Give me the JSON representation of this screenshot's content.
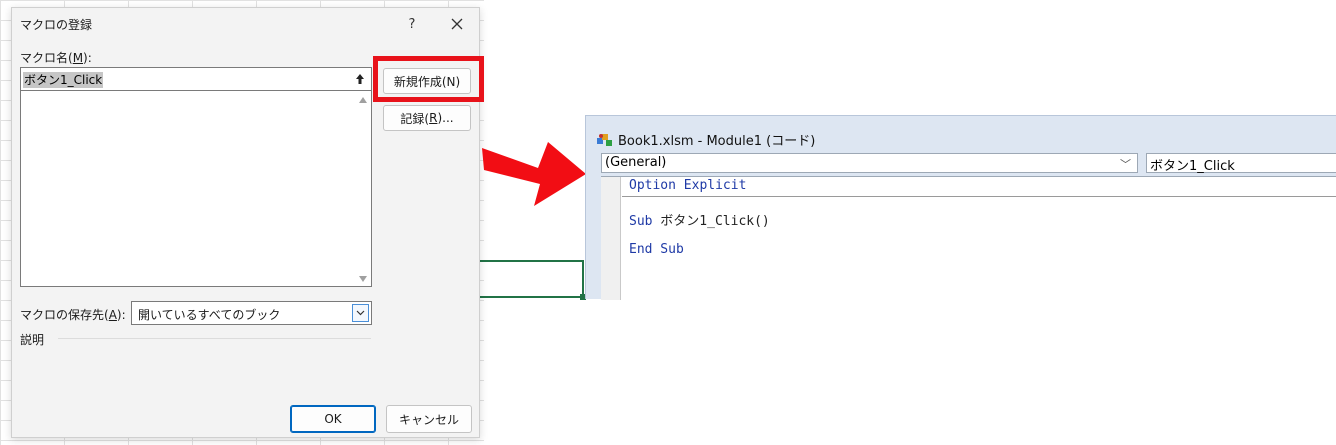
{
  "dialog": {
    "title": "マクロの登録",
    "help_label": "?",
    "macro_name_label_prefix": "マクロ名(",
    "macro_name_label_key": "M",
    "macro_name_label_suffix": "):",
    "macro_name_value": "ボタン1_Click",
    "new_button_label": "新規作成(N)",
    "record_button_prefix": "記録(",
    "record_button_key": "R",
    "record_button_suffix": ")...",
    "store_label_prefix": "マクロの保存先(",
    "store_label_key": "A",
    "store_label_suffix": "):",
    "store_value": "開いているすべてのブック",
    "description_label": "説明",
    "ok_label": "OK",
    "cancel_label": "キャンセル"
  },
  "vbe": {
    "title": "Book1.xlsm - Module1 (コード)",
    "object_combo": "(General)",
    "procedure_combo": "ボタン1_Click",
    "code": {
      "line1": "Option Explicit",
      "line2_kw": "Sub",
      "line2_rest": " ボタン1_Click()",
      "line3": "End Sub"
    }
  },
  "colors": {
    "highlight": "#e8121a",
    "arrow": "#f20d14",
    "keyword": "#1f3aa6",
    "excel_selection": "#217346"
  }
}
